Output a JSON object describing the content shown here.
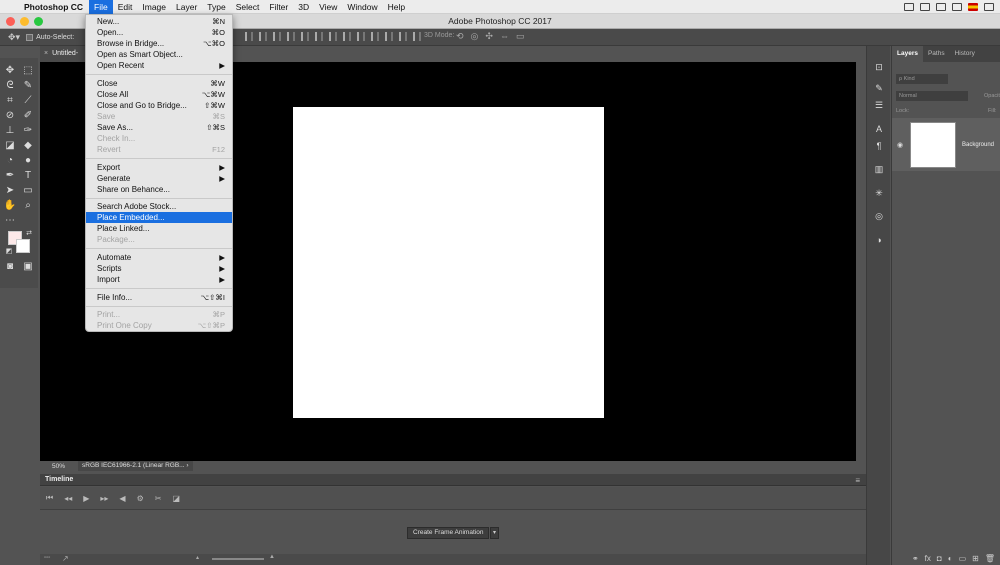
{
  "menubar": {
    "app_name": "Photoshop CC",
    "menus": [
      "File",
      "Edit",
      "Image",
      "Layer",
      "Type",
      "Select",
      "Filter",
      "3D",
      "View",
      "Window",
      "Help"
    ]
  },
  "window": {
    "title": "Adobe Photoshop CC 2017"
  },
  "options_bar": {
    "auto_select_label": "Auto-Select:",
    "mode_3d_label": "3D Mode:"
  },
  "document": {
    "tab_title": "Untitled-",
    "zoom": "50%",
    "color_profile": "sRGB IEC61966-2.1 (Linear RGB...",
    "profile_arrow": "›"
  },
  "file_menu": {
    "items": [
      {
        "label": "New...",
        "shortcut": "⌘N",
        "disabled": false
      },
      {
        "label": "Open...",
        "shortcut": "⌘O",
        "disabled": false
      },
      {
        "label": "Browse in Bridge...",
        "shortcut": "⌥⌘O",
        "disabled": false
      },
      {
        "label": "Open as Smart Object...",
        "shortcut": "",
        "disabled": false
      },
      {
        "label": "Open Recent",
        "shortcut": "▶",
        "disabled": false
      },
      {
        "label": "Close",
        "shortcut": "⌘W",
        "disabled": false
      },
      {
        "label": "Close All",
        "shortcut": "⌥⌘W",
        "disabled": false
      },
      {
        "label": "Close and Go to Bridge...",
        "shortcut": "⇧⌘W",
        "disabled": false
      },
      {
        "label": "Save",
        "shortcut": "⌘S",
        "disabled": true
      },
      {
        "label": "Save As...",
        "shortcut": "⇧⌘S",
        "disabled": false
      },
      {
        "label": "Check In...",
        "shortcut": "",
        "disabled": true
      },
      {
        "label": "Revert",
        "shortcut": "F12",
        "disabled": true
      },
      {
        "label": "Export",
        "shortcut": "▶",
        "disabled": false
      },
      {
        "label": "Generate",
        "shortcut": "▶",
        "disabled": false
      },
      {
        "label": "Share on Behance...",
        "shortcut": "",
        "disabled": false
      },
      {
        "label": "Search Adobe Stock...",
        "shortcut": "",
        "disabled": false
      },
      {
        "label": "Place Embedded...",
        "shortcut": "",
        "disabled": false,
        "highlighted": true
      },
      {
        "label": "Place Linked...",
        "shortcut": "",
        "disabled": false
      },
      {
        "label": "Package...",
        "shortcut": "",
        "disabled": true
      },
      {
        "label": "Automate",
        "shortcut": "▶",
        "disabled": false
      },
      {
        "label": "Scripts",
        "shortcut": "▶",
        "disabled": false
      },
      {
        "label": "Import",
        "shortcut": "▶",
        "disabled": false
      },
      {
        "label": "File Info...",
        "shortcut": "⌥⇧⌘I",
        "disabled": false
      },
      {
        "label": "Print...",
        "shortcut": "⌘P",
        "disabled": true
      },
      {
        "label": "Print One Copy",
        "shortcut": "⌥⇧⌘P",
        "disabled": true
      }
    ]
  },
  "timeline": {
    "title": "Timeline",
    "create_button": "Create Frame Animation"
  },
  "layers_panel": {
    "tabs": [
      "Layers",
      "Paths",
      "History"
    ],
    "kind_filter": "ρ Kind",
    "blend_mode": "Normal",
    "opacity_label": "Opacity:",
    "lock_label": "Lock:",
    "fill_label": "Fill:",
    "layer_name": "Background"
  },
  "colors": {
    "accent": "#1a6fe0",
    "canvas_bg": "#000000",
    "panel_bg": "#535353",
    "foreground_swatch": "#fde9e9",
    "background_swatch": "#ffffff"
  }
}
